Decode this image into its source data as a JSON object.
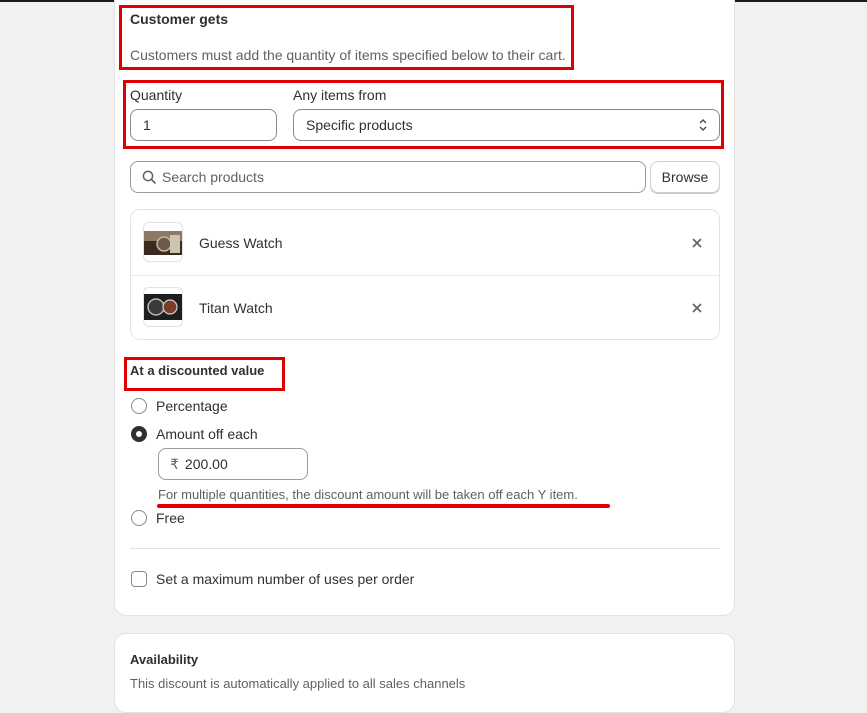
{
  "section": {
    "title": "Customer gets",
    "description": "Customers must add the quantity of items specified below to their cart."
  },
  "quantity": {
    "label": "Quantity",
    "value": "1"
  },
  "items_from": {
    "label": "Any items from",
    "selected": "Specific products"
  },
  "search": {
    "placeholder": "Search products",
    "browse_label": "Browse"
  },
  "products": [
    {
      "name": "Guess Watch"
    },
    {
      "name": "Titan Watch"
    }
  ],
  "discount": {
    "title": "At a discounted value",
    "options": [
      {
        "label": "Percentage",
        "checked": false
      },
      {
        "label": "Amount off each",
        "checked": true
      },
      {
        "label": "Free",
        "checked": false
      }
    ],
    "amount": {
      "currency": "₹",
      "value": "200.00"
    },
    "help_text": "For multiple quantities, the discount amount will be taken off each Y item."
  },
  "max_uses": {
    "label": "Set a maximum number of uses per order",
    "checked": false
  },
  "availability": {
    "title": "Availability",
    "description": "This discount is automatically applied to all sales channels"
  },
  "annotation_color": "#e10000"
}
